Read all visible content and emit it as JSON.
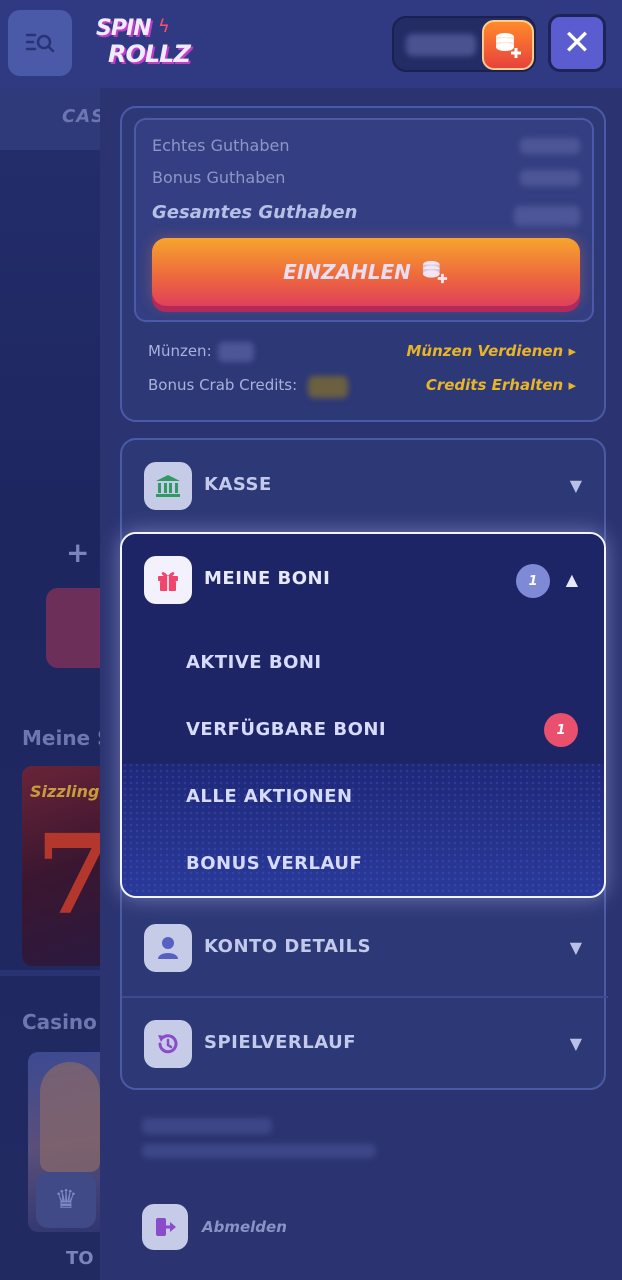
{
  "background": {
    "tab_label": "CAS",
    "section1_title": "Meine S",
    "game1_title": "Sizzling",
    "game1_symbol": "7",
    "section2_title": "Casino",
    "game2_label": "TO"
  },
  "header": {
    "logo_line1": "SPIN",
    "logo_line2": "ROLLZ",
    "close_label": "✕"
  },
  "wallet": {
    "real_balance_label": "Echtes Guthaben",
    "bonus_balance_label": "Bonus Guthaben",
    "total_balance_label": "Gesamtes Guthaben",
    "deposit_label": "EINZAHLEN",
    "coins_label": "Münzen:",
    "earn_coins_link": "Münzen Verdienen",
    "crab_credits_label": "Bonus Crab Credits:",
    "get_credits_link": "Credits Erhalten"
  },
  "menu": {
    "cashier": "KASSE",
    "my_bonuses": "MEINE BONI",
    "my_bonuses_count": "1",
    "sub_items": {
      "active": "AKTIVE BONI",
      "available": "VERFÜGBARE BONI",
      "available_count": "1",
      "all_promotions": "ALLE AKTIONEN",
      "history": "BONUS VERLAUF"
    },
    "account": "KONTO DETAILS",
    "game_history": "SPIELVERLAUF",
    "logout": "Abmelden"
  },
  "colors": {
    "accent_orange": "#ee6a3c",
    "link_gold": "#e8b42a",
    "badge_pink": "#e8506e",
    "badge_lavender": "#7f8ad6"
  }
}
